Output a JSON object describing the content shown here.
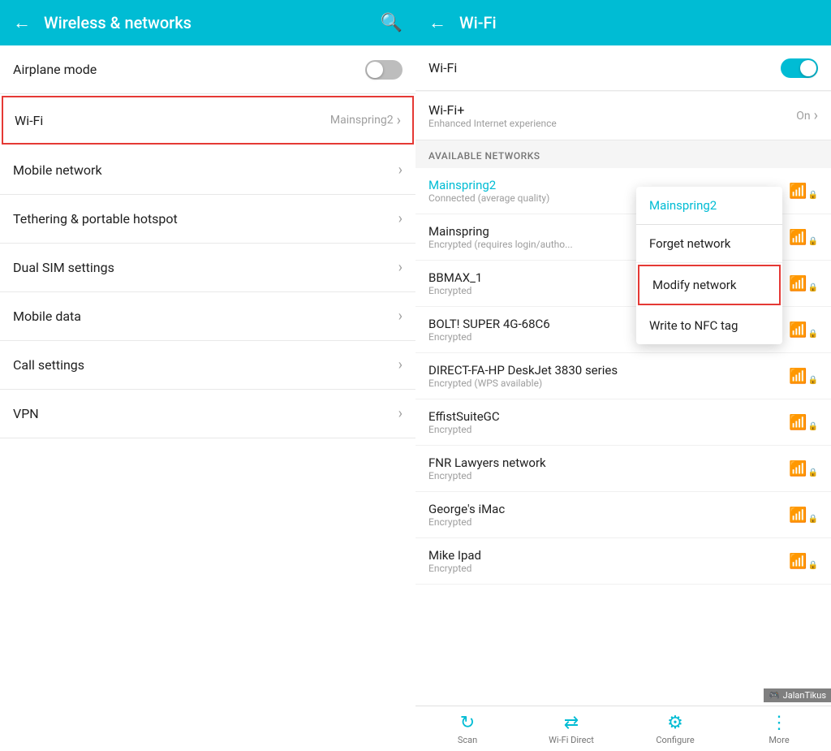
{
  "left": {
    "header": {
      "back_label": "←",
      "title": "Wireless & networks",
      "search_label": "🔍"
    },
    "items": [
      {
        "id": "airplane-mode",
        "label": "Airplane mode",
        "type": "toggle",
        "toggle_state": "off"
      },
      {
        "id": "wifi",
        "label": "Wi-Fi",
        "value": "Mainspring2",
        "type": "chevron",
        "highlighted": true
      },
      {
        "id": "mobile-network",
        "label": "Mobile network",
        "type": "chevron"
      },
      {
        "id": "tethering",
        "label": "Tethering & portable hotspot",
        "type": "chevron"
      },
      {
        "id": "dual-sim",
        "label": "Dual SIM settings",
        "type": "chevron"
      },
      {
        "id": "mobile-data",
        "label": "Mobile data",
        "type": "chevron"
      },
      {
        "id": "call-settings",
        "label": "Call settings",
        "type": "chevron"
      },
      {
        "id": "vpn",
        "label": "VPN",
        "type": "chevron"
      }
    ]
  },
  "right": {
    "header": {
      "back_label": "←",
      "title": "Wi-Fi"
    },
    "wifi_toggle": {
      "label": "Wi-Fi",
      "state": "on"
    },
    "wifi_plus": {
      "label": "Wi-Fi+",
      "subtitle": "Enhanced Internet experience",
      "value": "On"
    },
    "available_networks_header": "AVAILABLE NETWORKS",
    "networks": [
      {
        "id": "mainspring2",
        "name": "Mainspring2",
        "status": "Connected (average quality)",
        "connected": true,
        "signal": "medium"
      },
      {
        "id": "mainspring",
        "name": "Mainspring",
        "status": "Encrypted (requires login/autho...",
        "connected": false,
        "signal": "medium"
      },
      {
        "id": "bbmax1",
        "name": "BBMAX_1",
        "status": "Encrypted",
        "connected": false,
        "signal": "medium"
      },
      {
        "id": "bolt",
        "name": "BOLT! SUPER 4G-68C6",
        "status": "Encrypted",
        "connected": false,
        "signal": "medium"
      },
      {
        "id": "direct-hp",
        "name": "DIRECT-FA-HP DeskJet 3830 series",
        "status": "Encrypted (WPS available)",
        "connected": false,
        "signal": "low"
      },
      {
        "id": "effist",
        "name": "EffistSuiteGC",
        "status": "Encrypted",
        "connected": false,
        "signal": "medium"
      },
      {
        "id": "fnr",
        "name": "FNR Lawyers network",
        "status": "Encrypted",
        "connected": false,
        "signal": "medium"
      },
      {
        "id": "georges-imac",
        "name": "George's iMac",
        "status": "Encrypted",
        "connected": false,
        "signal": "medium"
      },
      {
        "id": "mike-ipad",
        "name": "Mike Ipad",
        "status": "Encrypted",
        "connected": false,
        "signal": "medium"
      }
    ],
    "context_menu": {
      "network_name": "Mainspring2",
      "items": [
        {
          "id": "forget",
          "label": "Forget network"
        },
        {
          "id": "modify",
          "label": "Modify network",
          "highlighted": true
        },
        {
          "id": "nfc",
          "label": "Write to NFC tag"
        }
      ]
    },
    "toolbar": {
      "items": [
        {
          "id": "scan",
          "icon": "↻",
          "label": "Scan"
        },
        {
          "id": "wifi-direct",
          "icon": "⇄",
          "label": "Wi-Fi Direct"
        },
        {
          "id": "configure",
          "icon": "⚙",
          "label": "Configure"
        },
        {
          "id": "more",
          "icon": "⋮",
          "label": "More"
        }
      ]
    },
    "watermark": "JalanTikus"
  }
}
